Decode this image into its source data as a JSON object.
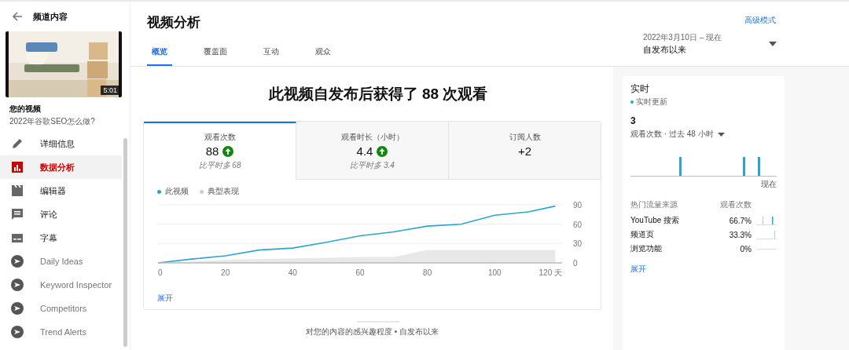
{
  "sidebar": {
    "back_label": "频道内容",
    "thumbnail": {
      "kind": "picture",
      "duration": "5:01"
    },
    "video_heading": "您的视频",
    "video_title": "2022年谷歌SEO怎么做?",
    "items": [
      {
        "label": "详细信息",
        "kind": "nav",
        "selected": false
      },
      {
        "label": "数据分析",
        "kind": "nav",
        "selected": true
      },
      {
        "label": "编辑器",
        "kind": "nav",
        "selected": false
      },
      {
        "label": "评论",
        "kind": "nav",
        "selected": false
      },
      {
        "label": "字幕",
        "kind": "nav",
        "selected": false
      },
      {
        "label": "Daily Ideas",
        "kind": "extension",
        "selected": false
      },
      {
        "label": "Keyword Inspector",
        "kind": "extension",
        "selected": false
      },
      {
        "label": "Competitors",
        "kind": "extension",
        "selected": false
      },
      {
        "label": "Trend Alerts",
        "kind": "extension",
        "selected": false
      }
    ]
  },
  "header": {
    "title": "视频分析",
    "advanced_link": "高级模式",
    "date_range": {
      "dates": "2022年3月10日 – 现在",
      "label": "自发布以来"
    },
    "tabs": [
      {
        "label": "概览",
        "selected": true
      },
      {
        "label": "覆盖面",
        "selected": false
      },
      {
        "label": "互动",
        "selected": false
      },
      {
        "label": "观众",
        "selected": false
      }
    ]
  },
  "overview": {
    "headline": "此视频自发布后获得了 88 次观看",
    "metrics": [
      {
        "label": "观看次数",
        "value": "88",
        "trend_up": true,
        "comparison": "比平时多 68",
        "selected": true
      },
      {
        "label": "观看时长（小时）",
        "value": "4.4",
        "trend_up": true,
        "comparison": "比平时多 3.4",
        "selected": false
      },
      {
        "label": "订阅人数",
        "value": "+2",
        "trend_up": false,
        "selected": false
      }
    ],
    "chart_data": {
      "type": "line",
      "x": [
        0,
        10,
        20,
        30,
        40,
        50,
        60,
        70,
        80,
        90,
        100,
        110,
        118
      ],
      "xlim": [
        0,
        120
      ],
      "ylim": [
        0,
        90
      ],
      "xticks": [
        0,
        20,
        40,
        60,
        80,
        100,
        {
          "value": 120,
          "label": "120 天"
        }
      ],
      "yticks": [
        0,
        30,
        60,
        90
      ],
      "series": [
        {
          "name": "此视频",
          "color": "#2ba6cb",
          "values": [
            0,
            6,
            11,
            20,
            23,
            32,
            42,
            48,
            57,
            60,
            74,
            79,
            88
          ]
        },
        {
          "name": "典型表现",
          "type": "area",
          "color": "#cccccc",
          "values": [
            0,
            2,
            5,
            6,
            7,
            8,
            9,
            9,
            20,
            20,
            20,
            20,
            20
          ]
        }
      ]
    },
    "expand_link": "展开",
    "footer_caption": "对您的内容的感兴趣程度 • 自发布以来"
  },
  "realtime": {
    "title": "实时",
    "live_label": "实时更新",
    "count": "3",
    "period": "观看次数 · 过去 48 小时",
    "chart_end_label": "现在",
    "sources_heading": "热门流量来源",
    "views_heading": "观看次数",
    "sources": [
      {
        "name": "YouTube 搜索",
        "share": "66.7%"
      },
      {
        "name": "频道页",
        "share": "33.3%"
      },
      {
        "name": "浏览功能",
        "share": "0%"
      }
    ],
    "expand_link": "展开"
  }
}
